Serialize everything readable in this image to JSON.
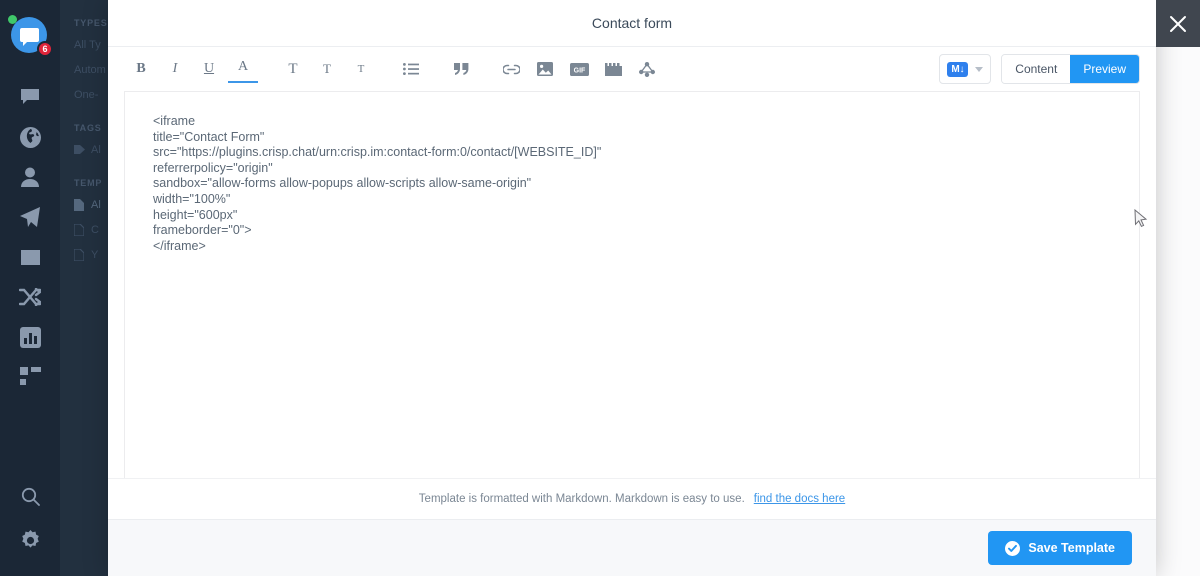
{
  "sidebar": {
    "logo": {
      "icon": "chat-bubble-icon",
      "status_icon": "online-dot-icon",
      "badge_count": "6"
    },
    "items": [
      {
        "name": "conversations",
        "icon": "chat-bubble-icon"
      },
      {
        "name": "visitors",
        "icon": "globe-icon"
      },
      {
        "name": "contacts",
        "icon": "person-icon"
      },
      {
        "name": "campaigns",
        "icon": "paper-plane-icon"
      },
      {
        "name": "helpdesk",
        "icon": "book-icon"
      },
      {
        "name": "plugins",
        "icon": "shuffle-icon"
      },
      {
        "name": "analytics",
        "icon": "bar-chart-icon"
      },
      {
        "name": "apps",
        "icon": "grid-icon"
      }
    ],
    "bottom_items": [
      {
        "name": "search",
        "icon": "search-icon"
      },
      {
        "name": "settings",
        "icon": "gear-icon"
      }
    ]
  },
  "list_panel": {
    "sections": [
      {
        "label": "TYPES",
        "items": [
          {
            "label": "All Ty",
            "icon": "",
            "active": false
          },
          {
            "label": "Autom",
            "icon": "",
            "active": false
          },
          {
            "label": "One-",
            "icon": "",
            "active": false
          }
        ]
      },
      {
        "label": "TAGS",
        "items": [
          {
            "label": "Al",
            "icon": "tag-icon",
            "active": false
          }
        ]
      },
      {
        "label": "TEMP",
        "items": [
          {
            "label": "Al",
            "icon": "document-icon",
            "active": true
          },
          {
            "label": "C",
            "icon": "document-icon",
            "active": false
          },
          {
            "label": "Y",
            "icon": "document-icon",
            "active": false
          }
        ]
      }
    ]
  },
  "modal": {
    "title": "Contact form",
    "close_icon": "close-icon",
    "toolbar": {
      "format_buttons": [
        {
          "name": "bold",
          "label": "B",
          "icon": "bold-icon"
        },
        {
          "name": "italic",
          "label": "I",
          "icon": "italic-icon"
        },
        {
          "name": "underline",
          "label": "U",
          "icon": "underline-icon"
        },
        {
          "name": "text-color",
          "label": "A",
          "icon": "text-color-icon"
        }
      ],
      "heading_buttons": [
        {
          "name": "heading-large",
          "label": "T",
          "icon": "heading-large-icon"
        },
        {
          "name": "heading-medium",
          "label": "T",
          "icon": "heading-medium-icon"
        },
        {
          "name": "heading-small",
          "label": "T",
          "icon": "heading-small-icon"
        }
      ],
      "block_buttons": [
        {
          "name": "bullet-list",
          "icon": "list-icon"
        },
        {
          "name": "blockquote",
          "icon": "quote-icon"
        }
      ],
      "insert_buttons": [
        {
          "name": "link",
          "icon": "link-icon"
        },
        {
          "name": "image",
          "icon": "image-icon"
        },
        {
          "name": "gif",
          "icon": "gif-icon"
        },
        {
          "name": "video",
          "icon": "video-icon"
        },
        {
          "name": "shortcut",
          "icon": "shortcut-icon"
        }
      ],
      "markdown_badge": "M↓",
      "markdown_chevron_icon": "chevron-down-icon",
      "segments": [
        {
          "label": "Content",
          "active": false
        },
        {
          "label": "Preview",
          "active": true
        }
      ]
    },
    "editor": {
      "content": "<iframe\ntitle=\"Contact Form\"\nsrc=\"https://plugins.crisp.chat/urn:crisp.im:contact-form:0/contact/[WEBSITE_ID]\"\nreferrerpolicy=\"origin\"\nsandbox=\"allow-forms allow-popups allow-scripts allow-same-origin\"\nwidth=\"100%\"\nheight=\"600px\"\nframeborder=\"0\">\n</iframe>"
    },
    "footer": {
      "hint_text": "Template is formatted with Markdown. Markdown is easy to use.",
      "hint_link": "find the docs here",
      "save_label": "Save Template",
      "save_icon": "check-circle-icon"
    }
  },
  "colors": {
    "accent": "#2196f3",
    "link": "#3c96e8",
    "sidebar": "#1b2736",
    "panel": "#22303f",
    "badge": "#e0243a",
    "online": "#3fc86a"
  }
}
